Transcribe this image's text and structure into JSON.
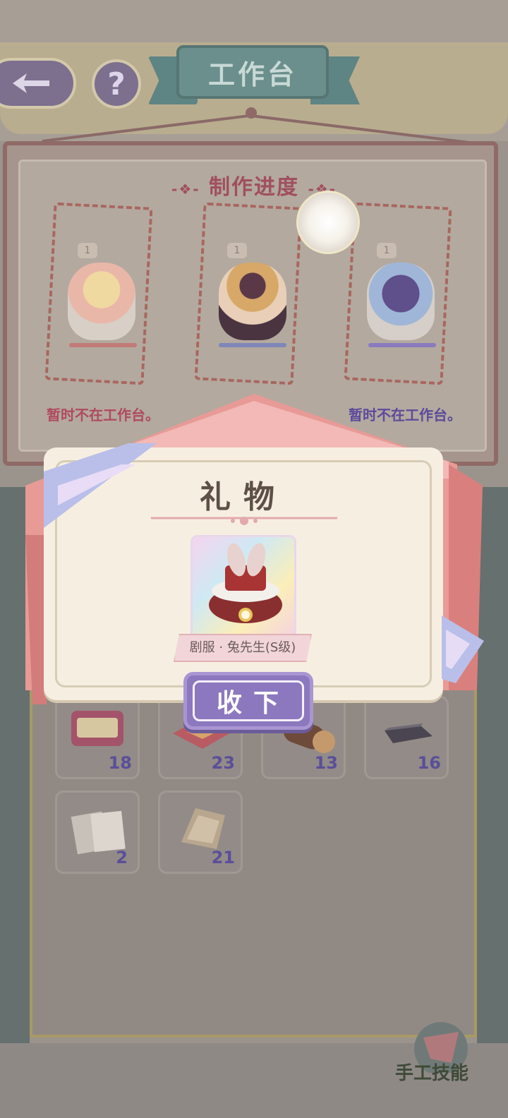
{
  "header": {
    "title": "工作台",
    "back_icon": "back-arrow-icon",
    "help_label": "?"
  },
  "progress": {
    "title": "制作进度",
    "slots": [
      {
        "badge": "1",
        "status": "暂时不在工作台。",
        "bar_color": "#c27a78",
        "status_color": "#b04a5e"
      },
      {
        "badge": "1",
        "status": "",
        "bar_color": "#7f86b8",
        "status_color": "#5b4a9a"
      },
      {
        "badge": "1",
        "status": "暂时不在工作台。",
        "bar_color": "#8a7bbe",
        "status_color": "#5b4a9a"
      }
    ]
  },
  "materials": [
    {
      "count": "18",
      "icon": "sewing-kit-icon"
    },
    {
      "count": "23",
      "icon": "fabric-tray-icon"
    },
    {
      "count": "13",
      "icon": "wood-roll-icon"
    },
    {
      "count": "16",
      "icon": "metal-bar-icon"
    },
    {
      "count": "2",
      "icon": "paper-stack-icon"
    },
    {
      "count": "21",
      "icon": "fur-fabric-icon"
    }
  ],
  "gift_popup": {
    "title": "礼物",
    "item_name": "剧服 · 兔先生(S级)",
    "accept_label": "收下"
  },
  "footer": {
    "skill_label": "手工技能"
  },
  "colors": {
    "accent_purple": "#8c78be",
    "envelope_pink": "#e89a96",
    "card_cream": "#f6efe1"
  }
}
